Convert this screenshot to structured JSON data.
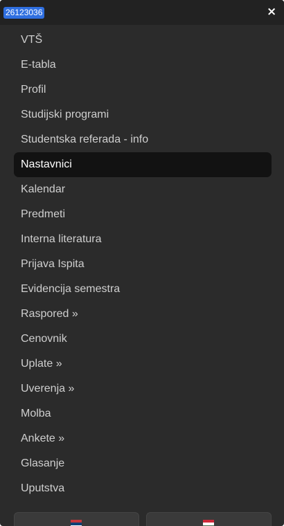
{
  "header": {
    "badge": "26123036",
    "close_glyph": "×",
    "close_icon": "close-icon"
  },
  "menu": {
    "active_index": 5,
    "items": [
      {
        "label": "VTŠ"
      },
      {
        "label": "E-tabla"
      },
      {
        "label": "Profil"
      },
      {
        "label": "Studijski programi"
      },
      {
        "label": "Studentska referada - info"
      },
      {
        "label": "Nastavnici"
      },
      {
        "label": "Kalendar"
      },
      {
        "label": "Predmeti"
      },
      {
        "label": "Interna literatura"
      },
      {
        "label": "Prijava Ispita"
      },
      {
        "label": "Evidencija semestra"
      },
      {
        "label": "Raspored »"
      },
      {
        "label": "Cenovnik"
      },
      {
        "label": "Uplate »"
      },
      {
        "label": "Uverenja »"
      },
      {
        "label": "Molba"
      },
      {
        "label": "Ankete »"
      },
      {
        "label": "Glasanje"
      },
      {
        "label": "Uputstva"
      }
    ]
  },
  "languages": [
    {
      "icon": "serbia-flag-icon",
      "colors": [
        "#c6363c",
        "#0c4076",
        "#ffffff"
      ]
    },
    {
      "icon": "hungary-flag-icon",
      "colors": [
        "#ce2939",
        "#ffffff",
        "#477050"
      ]
    }
  ],
  "colors": {
    "panel_bg": "#2b2b2b",
    "active_bg": "#121212",
    "badge_bg": "#2f6fe0",
    "text": "#cfcfcf"
  }
}
